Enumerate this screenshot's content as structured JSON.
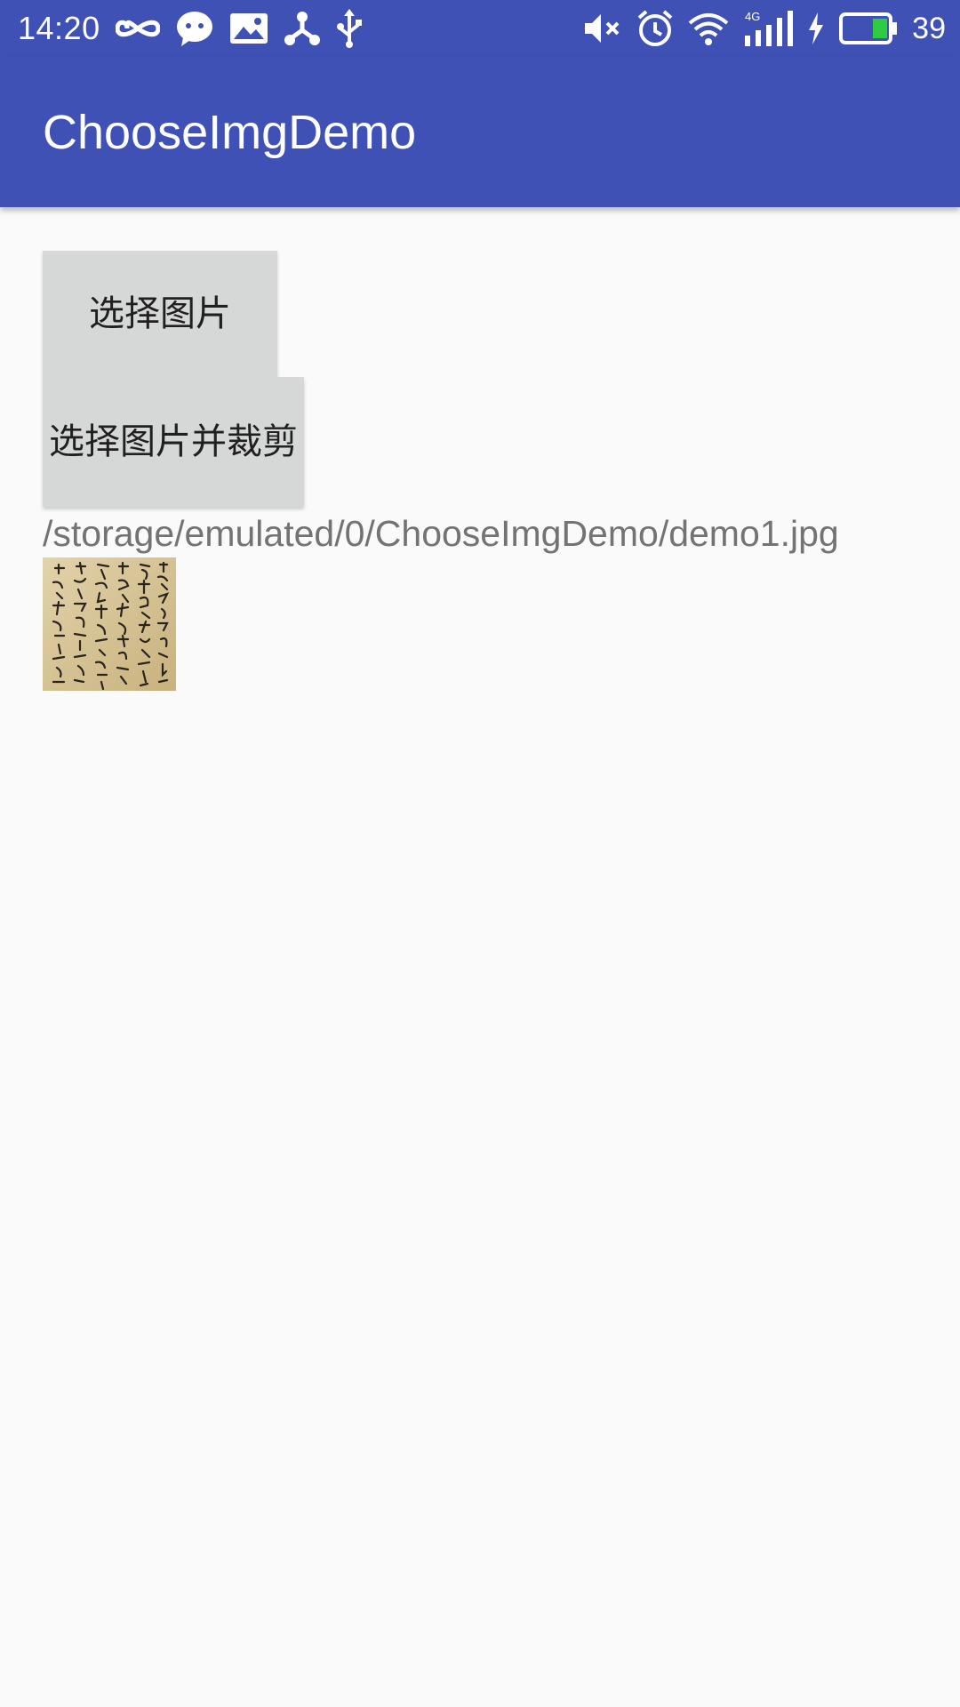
{
  "status_bar": {
    "time": "14:20",
    "battery_percent": "39",
    "left_icons": [
      "infinity-icon",
      "chat-bubble-icon",
      "image-icon",
      "share-nodes-icon",
      "usb-icon"
    ],
    "right_icons": [
      "mute-icon",
      "alarm-icon",
      "wifi-icon",
      "signal-4g-icon",
      "charging-icon",
      "battery-icon"
    ],
    "background": "#3f51b5",
    "signal_label": "4G"
  },
  "app_bar": {
    "title": "ChooseImgDemo",
    "background": "#3f51b5"
  },
  "buttons": {
    "choose_image": "选择图片",
    "choose_and_crop": "选择图片并裁剪"
  },
  "image_path": "/storage/emulated/0/ChooseImgDemo/demo1.jpg",
  "thumbnail": {
    "icon": "calligraphy-image-icon"
  }
}
